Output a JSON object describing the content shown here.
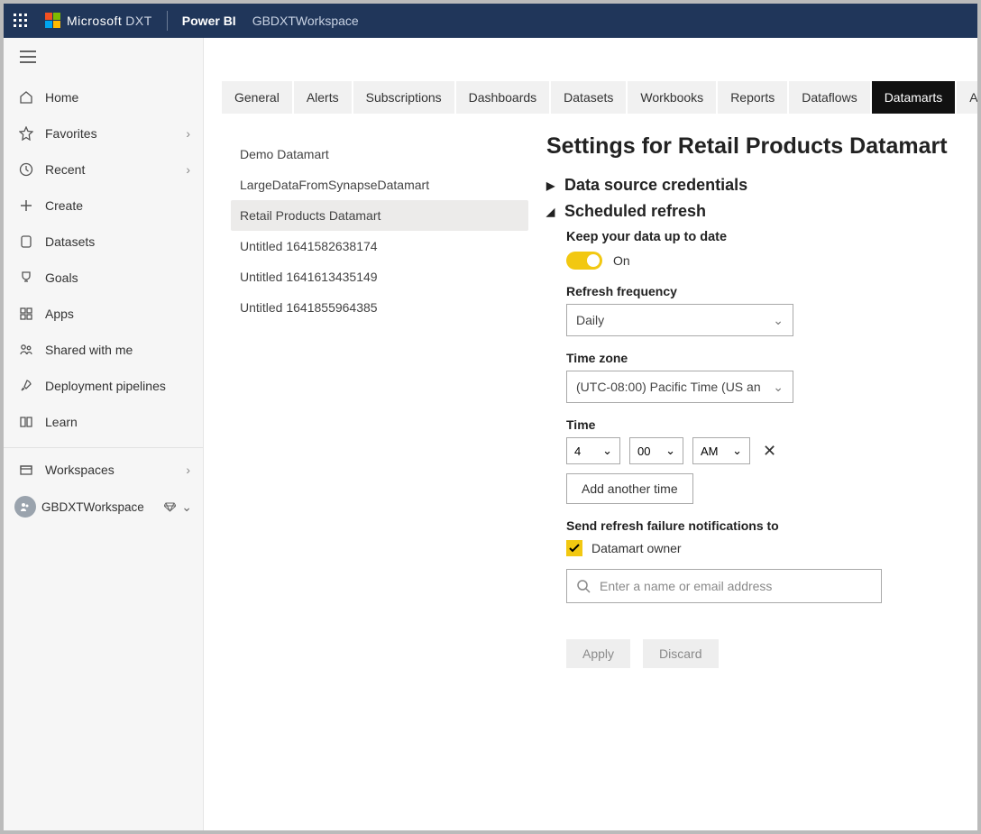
{
  "topbar": {
    "brand": "Microsoft",
    "brand_suffix": "DXT",
    "app": "Power BI",
    "workspace": "GBDXTWorkspace"
  },
  "sidebar": {
    "items": [
      {
        "icon": "home",
        "label": "Home",
        "expand": false
      },
      {
        "icon": "star",
        "label": "Favorites",
        "expand": true
      },
      {
        "icon": "clock",
        "label": "Recent",
        "expand": true
      },
      {
        "icon": "plus",
        "label": "Create",
        "expand": false
      },
      {
        "icon": "db",
        "label": "Datasets",
        "expand": false
      },
      {
        "icon": "trophy",
        "label": "Goals",
        "expand": false
      },
      {
        "icon": "apps",
        "label": "Apps",
        "expand": false
      },
      {
        "icon": "shared",
        "label": "Shared with me",
        "expand": false
      },
      {
        "icon": "rocket",
        "label": "Deployment pipelines",
        "expand": false
      },
      {
        "icon": "book",
        "label": "Learn",
        "expand": false
      }
    ],
    "workspaces_label": "Workspaces",
    "current_workspace": "GBDXTWorkspace"
  },
  "tabs": [
    "General",
    "Alerts",
    "Subscriptions",
    "Dashboards",
    "Datasets",
    "Workbooks",
    "Reports",
    "Dataflows",
    "Datamarts",
    "App"
  ],
  "tabs_active_index": 8,
  "datamarts": [
    "Demo Datamart",
    "LargeDataFromSynapseDatamart",
    "Retail Products Datamart",
    "Untitled 1641582638174",
    "Untitled 1641613435149",
    "Untitled 1641855964385"
  ],
  "datamarts_selected_index": 2,
  "settings": {
    "title": "Settings for Retail Products Datamart",
    "section_credentials": "Data source credentials",
    "section_refresh": "Scheduled refresh",
    "keep_data_label": "Keep your data up to date",
    "toggle_state": "On",
    "freq_label": "Refresh frequency",
    "freq_value": "Daily",
    "tz_label": "Time zone",
    "tz_value": "(UTC-08:00) Pacific Time (US an",
    "time_label": "Time",
    "time_hour": "4",
    "time_min": "00",
    "time_ampm": "AM",
    "add_time_btn": "Add another time",
    "notify_label": "Send refresh failure notifications to",
    "notify_owner": "Datamart owner",
    "search_placeholder": "Enter a name or email address",
    "apply_btn": "Apply",
    "discard_btn": "Discard"
  }
}
